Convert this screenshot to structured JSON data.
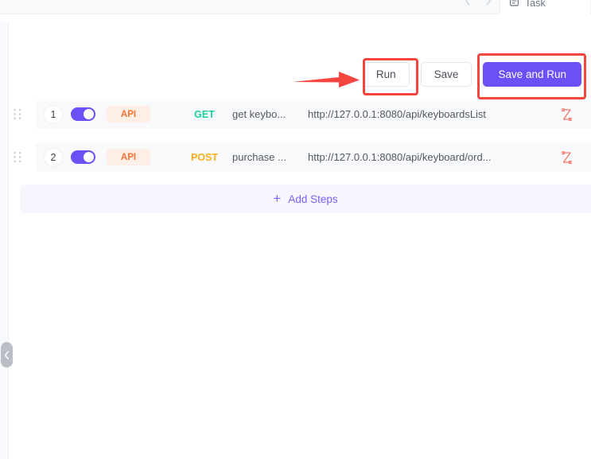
{
  "topbar": {
    "back_icon": "chevron-left-icon",
    "forward_icon": "chevron-right-icon",
    "tab": {
      "icon": "document-icon",
      "label": "Task"
    }
  },
  "sidebar": {
    "collapse_icon": "chevron-left-icon"
  },
  "actions": {
    "run_label": "Run",
    "save_label": "Save",
    "save_and_run_label": "Save and Run",
    "primary_color": "#6c4ff6",
    "annotation_color": "#f4463f"
  },
  "steps": {
    "rows": [
      {
        "index": "1",
        "enabled": true,
        "type": "API",
        "method": "GET",
        "method_color": "#1ecfa4",
        "name": "get keybo...",
        "url": "http://127.0.0.1:8080/api/keyboardsList",
        "action_icon": "run-step-icon"
      },
      {
        "index": "2",
        "enabled": true,
        "type": "API",
        "method": "POST",
        "method_color": "#fcaf17",
        "name": "purchase ...",
        "url": "http://127.0.0.1:8080/api/keyboard/ord...",
        "action_icon": "run-step-icon"
      }
    ],
    "add_steps_label": "Add Steps",
    "add_steps_icon": "plus-icon",
    "drag_icon": "drag-handle-icon"
  }
}
